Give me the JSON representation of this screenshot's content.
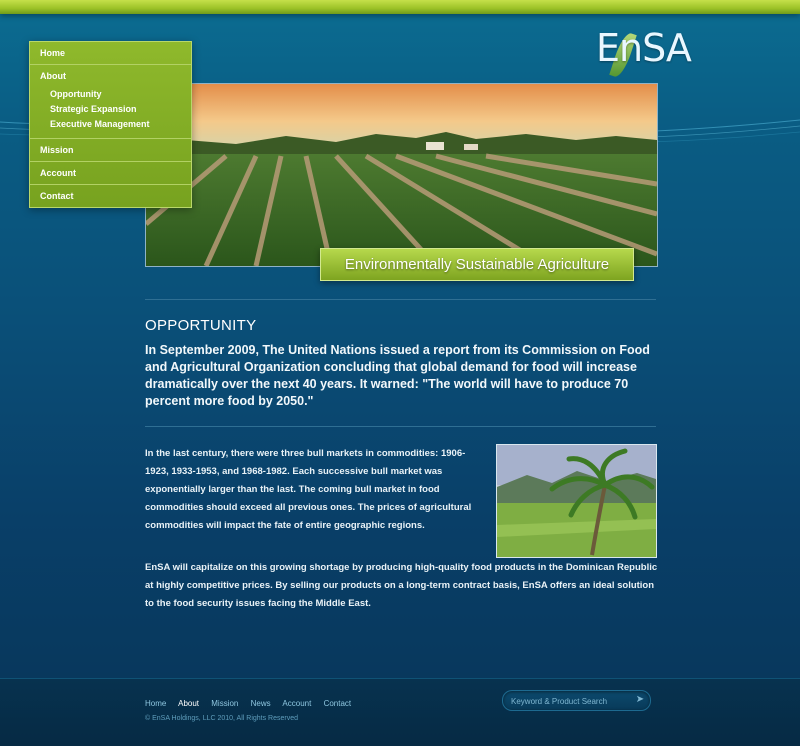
{
  "brand": {
    "logo_text": "EnSA",
    "accent": "#8fb92c",
    "background": "#0a4f78"
  },
  "nav": {
    "home": "Home",
    "about": "About",
    "about_sub": [
      "Opportunity",
      "Strategic Expansion",
      "Executive Management"
    ],
    "mission": "Mission",
    "account": "Account",
    "contact": "Contact"
  },
  "hero": {
    "banner": "Environmentally Sustainable Agriculture"
  },
  "content": {
    "heading": "OPPORTUNITY",
    "intro": "In September 2009, The United Nations issued a report from its Commission on Food and Agricultural Organization concluding that global demand for food will increase dramatically over the next 40 years. It warned: \"The world will have to produce 70 percent more food by 2050.\"",
    "para1": "In the last century, there were three bull markets in commodities: 1906-1923, 1933-1953, and 1968-1982. Each successive bull market was exponentially larger than the last. The coming bull market in food commodities should exceed all previous ones. The prices of agricultural commodities will impact the fate of entire geographic regions.",
    "para2": "EnSA will capitalize on this growing shortage by producing high-quality food products in the Dominican Republic at highly competitive prices. By selling our products on a long-term contract basis, EnSA offers an ideal solution to the food security issues facing the Middle East."
  },
  "footer": {
    "links": [
      "Home",
      "About",
      "Mission",
      "News",
      "Account",
      "Contact"
    ],
    "active_link": "About",
    "copyright": "© EnSA Holdings, LLC 2010, All Rights Reserved",
    "search_placeholder": "Keyword & Product Search"
  }
}
